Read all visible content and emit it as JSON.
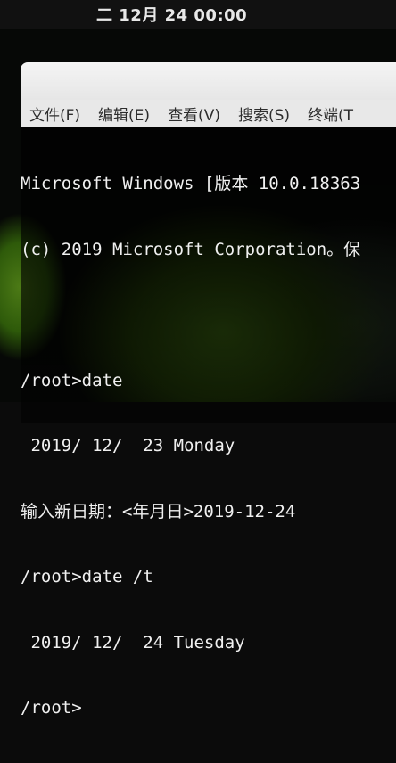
{
  "top_panel": {
    "clock": "二 12月 24 00:00"
  },
  "menu": {
    "items": [
      {
        "label": "文件(F)"
      },
      {
        "label": "编辑(E)"
      },
      {
        "label": "查看(V)"
      },
      {
        "label": "搜索(S)"
      },
      {
        "label": "终端(T"
      }
    ]
  },
  "terminal": {
    "lines": [
      "Microsoft Windows [版本 10.0.18363",
      "(c) 2019 Microsoft Corporation。保",
      "",
      "/root>date",
      " 2019/ 12/  23 Monday",
      "输入新日期：<年月日>2019-12-24",
      "/root>date /t",
      " 2019/ 12/  24 Tuesday",
      "/root>"
    ]
  }
}
